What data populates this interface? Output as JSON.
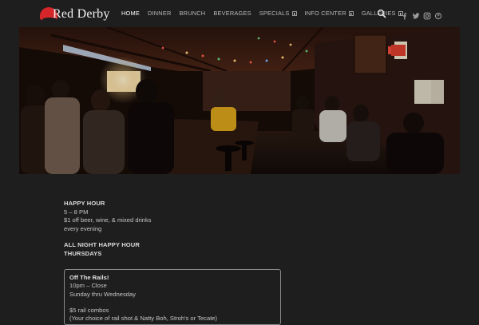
{
  "brand": {
    "name": "Red Derby"
  },
  "nav": {
    "items": [
      {
        "label": "HOME",
        "active": true,
        "has_submenu": false
      },
      {
        "label": "DINNER",
        "active": false,
        "has_submenu": false
      },
      {
        "label": "BRUNCH",
        "active": false,
        "has_submenu": false
      },
      {
        "label": "BEVERAGES",
        "active": false,
        "has_submenu": false
      },
      {
        "label": "SPECIALS",
        "active": false,
        "has_submenu": true
      },
      {
        "label": "INFO CENTER",
        "active": false,
        "has_submenu": true
      },
      {
        "label": "GALLERIES",
        "active": false,
        "has_submenu": true
      }
    ],
    "icons": [
      "search-icon"
    ],
    "social": [
      "facebook-icon",
      "twitter-icon",
      "instagram-icon",
      "foursquare-icon"
    ]
  },
  "hero": {
    "image": "bar-interior-photo"
  },
  "specials": {
    "happy_hour": {
      "title": "HAPPY HOUR",
      "time": "5 – 8 PM",
      "details": "$1 off beer, wine, & mixed drinks",
      "when": "every evening"
    },
    "all_night": {
      "title_line1": "ALL NIGHT HAPPY HOUR",
      "title_line2": "THURSDAYS"
    },
    "off_the_rails": {
      "title": "Off The Rails!",
      "time": "10pm – Close",
      "days": "Sunday thru Wednesday",
      "combo": "$5 rail combos",
      "combo_details": "(Your choice of rail shot & Natty Boh, Stroh's or Tecate)"
    }
  },
  "colors": {
    "background": "#1e1e1e",
    "accent": "#d7262a",
    "text": "#c5c5c5"
  }
}
